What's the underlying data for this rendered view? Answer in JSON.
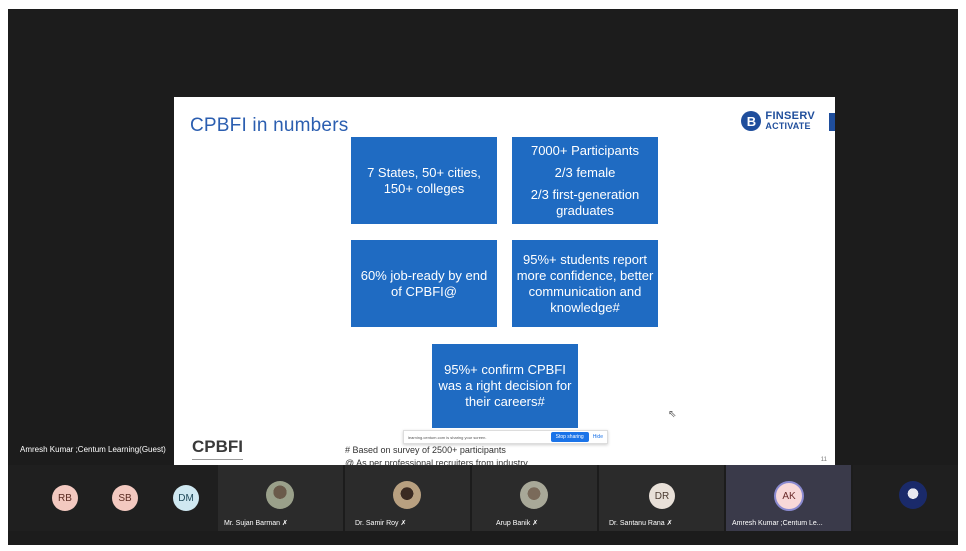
{
  "slide": {
    "title": "CPBFI in numbers",
    "logo_line1": "FINSERV",
    "logo_line2": "ACTIVATE",
    "logo_badge": "B",
    "boxes": [
      {
        "lines": [
          "7 States, 50+ cities,",
          "150+ colleges"
        ]
      },
      {
        "lines": [
          "7000+ Participants",
          "2/3 female",
          "2/3 first-generation graduates"
        ]
      },
      {
        "lines": [
          "60% job-ready by end of CPBFI@"
        ]
      },
      {
        "lines": [
          "95%+ students report more confidence, better communication and knowledge#"
        ]
      },
      {
        "lines": [
          "95%+ confirm CPBFI was a right decision for their careers#"
        ]
      }
    ],
    "brand": "CPBFI",
    "footnote1": "# Based on survey of 2500+ participants",
    "footnote2": "@ As per professional recruiters from industry",
    "page_number": "11"
  },
  "share_bar": {
    "text": "learning.centum.com is sharing your screen.",
    "stop_label": "Stop sharing",
    "hide_label": "Hide"
  },
  "presenter_label": "Amresh Kumar ;Centum Learning(Guest)",
  "participants": [
    {
      "initials": "RB",
      "color": "#f3c9c0",
      "text_color": "#5a2a20"
    },
    {
      "initials": "SB",
      "color": "#f3c9c0",
      "text_color": "#5a2a20"
    },
    {
      "initials": "DM",
      "color": "#cfe8f1",
      "text_color": "#204a5a"
    },
    {
      "name": "Mr. Sujan Barman",
      "photo": "photo-avatar"
    },
    {
      "name": "Dr. Samir Roy",
      "photo": "photo-avatar"
    },
    {
      "name": "Arup Banik",
      "photo": "photo-avatar"
    },
    {
      "name": "Dr. Santanu Rana",
      "initials": "DR",
      "color": "#e8e0d8",
      "text_color": "#4a3a30"
    },
    {
      "name": "Amresh Kumar ;Centum Le...",
      "initials": "AK",
      "color": "#f8d8d8",
      "text_color": "#6a2a2a"
    },
    {
      "photo": "photo-avatar"
    }
  ],
  "mic_glyph": "ꕔ"
}
